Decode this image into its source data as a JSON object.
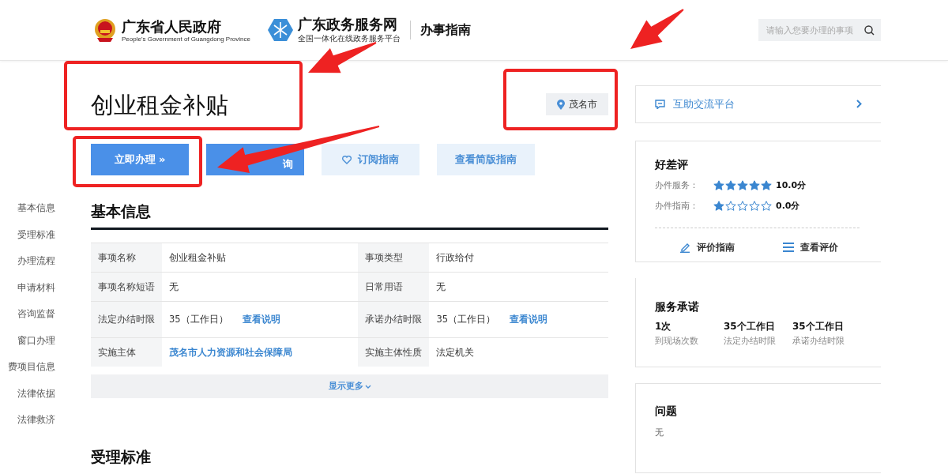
{
  "header": {
    "gov_title": "广东省人民政府",
    "gov_subtitle": "People's Government of Guangdong Province",
    "portal_title": "广东政务服务网",
    "portal_subtitle": "全国一体化在线政务服务平台",
    "section": "办事指南",
    "search": {
      "placeholder": "请输入您要办理的事项"
    }
  },
  "side_nav": [
    {
      "label": "基本信息"
    },
    {
      "label": "受理标准"
    },
    {
      "label": "办理流程"
    },
    {
      "label": "申请材料"
    },
    {
      "label": "咨询监督"
    },
    {
      "label": "窗口办理"
    },
    {
      "label": "费项目信息"
    },
    {
      "label": "法律依据"
    },
    {
      "label": "法律救济"
    }
  ],
  "title": "创业租金补贴",
  "location": "茂名市",
  "buttons": [
    {
      "label": "立即办理 »",
      "kind": "primary"
    },
    {
      "label": "询",
      "kind": "primary"
    },
    {
      "label": "订阅指南",
      "kind": "subscribe"
    },
    {
      "label": "查看简版指南",
      "kind": "secondary"
    }
  ],
  "basic_info": {
    "heading": "基本信息",
    "rows": [
      [
        {
          "label": "事项名称",
          "value": "创业租金补贴"
        },
        {
          "label": "事项类型",
          "value": "行政给付"
        }
      ],
      [
        {
          "label": "事项名称短语",
          "value": "无"
        },
        {
          "label": "日常用语",
          "value": "无"
        }
      ],
      [
        {
          "label": "法定办结时限",
          "value": "35（工作日）",
          "link": "查看说明"
        },
        {
          "label": "承诺办结时限",
          "value": "35（工作日）",
          "link": "查看说明"
        }
      ],
      [
        {
          "label": "实施主体",
          "value": "茂名市人力资源和社会保障局",
          "value_is_link": true
        },
        {
          "label": "实施主体性质",
          "value": "法定机关"
        }
      ]
    ],
    "more": "显示更多"
  },
  "next_heading": "受理标准",
  "exchange": {
    "label": "互助交流平台"
  },
  "ratings": {
    "title": "好差评",
    "rows": [
      {
        "label": "办件服务：",
        "stars": 5,
        "score": "10.0分"
      },
      {
        "label": "办件指南：",
        "stars": 1,
        "score": "0.0分"
      }
    ],
    "actions": [
      {
        "label": "评价指南"
      },
      {
        "label": "查看评价"
      }
    ]
  },
  "promise": {
    "title": "服务承诺",
    "items": [
      {
        "value": "1次",
        "label": "到现场次数"
      },
      {
        "value": "35个工作日",
        "label": "法定办结时限"
      },
      {
        "value": "35个工作日",
        "label": "承诺办结时限"
      }
    ]
  },
  "faq": {
    "title": "问题",
    "text": "无"
  }
}
